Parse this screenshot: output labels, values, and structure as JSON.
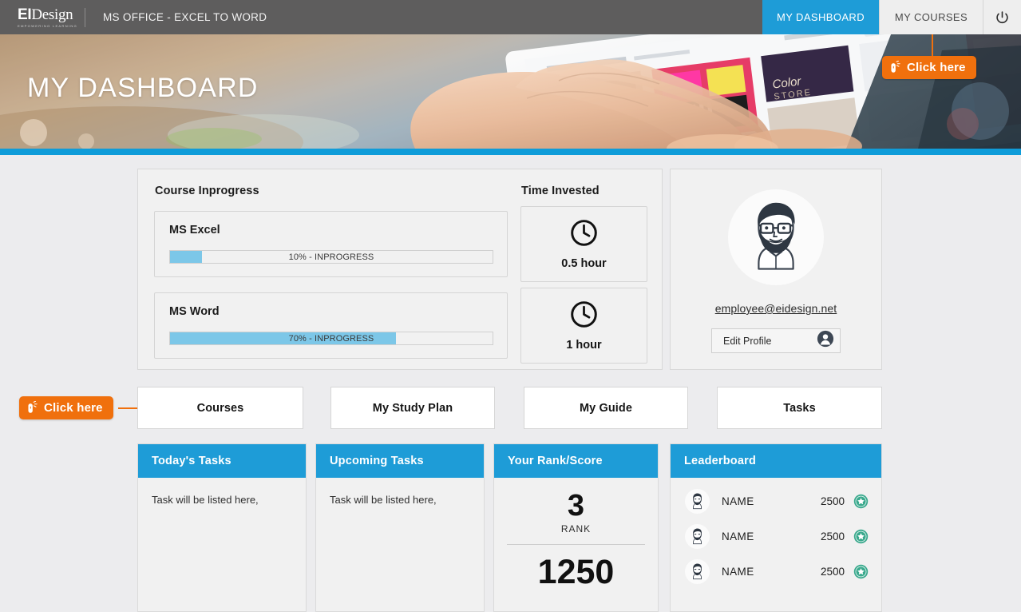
{
  "topbar": {
    "logo_main_bold": "EI",
    "logo_main_light": "Design",
    "logo_tagline": "EMPOWERING LEARNING",
    "course_title": "MS OFFICE - EXCEL TO WORD",
    "nav": [
      {
        "label": "MY DASHBOARD",
        "active": true
      },
      {
        "label": "MY COURSES",
        "active": false
      }
    ],
    "power_icon": "power-icon"
  },
  "hero": {
    "title": "MY DASHBOARD",
    "accent_color": "#0f9cd9"
  },
  "callouts": {
    "top_right": {
      "label": "Click here",
      "icon": "mouse-cursor-icon"
    },
    "left_row": {
      "label": "Click here",
      "icon": "mouse-cursor-icon"
    },
    "color": "#f0700d"
  },
  "course_panel": {
    "heading": "Course Inprogress",
    "courses": [
      {
        "name": "MS Excel",
        "percent": 10,
        "status_label": "10% - INPROGRESS"
      },
      {
        "name": "MS Word",
        "percent": 70,
        "status_label": "70% - INPROGRESS"
      }
    ],
    "progress_fill_color": "#7cc7e8"
  },
  "time_panel": {
    "heading": "Time Invested",
    "entries": [
      {
        "value": "0.5 hour",
        "icon": "clock-icon"
      },
      {
        "value": "1 hour",
        "icon": "clock-icon"
      }
    ]
  },
  "profile": {
    "avatar_icon": "user-avatar-icon",
    "email": "employee@eidesign.net",
    "edit_button_label": "Edit Profile",
    "edit_button_icon": "person-icon"
  },
  "buttons": [
    {
      "label": "Courses"
    },
    {
      "label": "My Study Plan"
    },
    {
      "label": "My Guide"
    },
    {
      "label": "Tasks"
    }
  ],
  "bottom_cards": {
    "todays_tasks": {
      "title": "Today's Tasks",
      "body": "Task will be listed here,"
    },
    "upcoming_tasks": {
      "title": "Upcoming Tasks",
      "body": "Task will be listed here,"
    },
    "rank_score": {
      "title": "Your Rank/Score",
      "rank_value": "3",
      "rank_label": "RANK",
      "score_value": "1250"
    },
    "leaderboard": {
      "title": "Leaderboard",
      "rows": [
        {
          "name": "NAME",
          "score": "2500",
          "badge_icon": "star-badge-icon"
        },
        {
          "name": "NAME",
          "score": "2500",
          "badge_icon": "star-badge-icon"
        },
        {
          "name": "NAME",
          "score": "2500",
          "badge_icon": "star-badge-icon"
        }
      ],
      "badge_color": "#3aa98d"
    },
    "header_color": "#1e9cd7"
  }
}
